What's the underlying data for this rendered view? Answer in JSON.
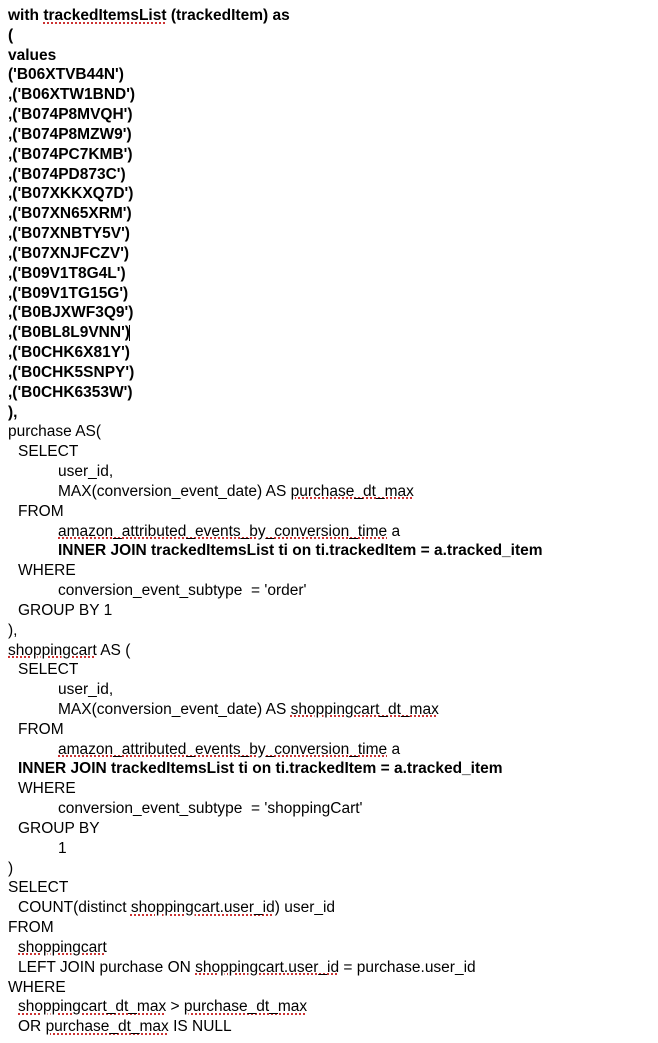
{
  "sql": {
    "with_header": {
      "pre": "with ",
      "cte_name": "trackedItemsList",
      "args": " (trackedItem) as"
    },
    "open_paren": "(",
    "values_kw": "values",
    "tracked_items": [
      "('B06XTVB44N')",
      ",('B06XTW1BND')",
      ",('B074P8MVQH')",
      ",('B074P8MZW9')",
      ",('B074PC7KMB')",
      ",('B074PD873C')",
      ",('B07XKKXQ7D')",
      ",('B07XN65XRM')",
      ",('B07XNBTY5V')",
      ",('B07XNJFCZV')",
      ",('B09V1T8G4L')",
      ",('B09V1TG15G')",
      ",('B0BJXWF3Q9')",
      ",('B0BL8L9VNN')",
      ",('B0CHK6X81Y')",
      ",('B0CHK5SNPY')",
      ",('B0CHK6353W')"
    ],
    "cursor_index": 13,
    "close_paren_comma": "),",
    "purchase_header": "purchase AS(",
    "select_kw": "SELECT",
    "user_id_col": "user_id,",
    "purchase_max": {
      "pre": "MAX(conversion_event_date) AS ",
      "spell": "purchase_dt_max"
    },
    "from_kw": "FROM",
    "table_a": {
      "spell": "amazon_attributed_events_by_conversion_time",
      "suffix": " a"
    },
    "join1": "INNER JOIN trackedItemsList ti on ti.trackedItem = a.tracked_item",
    "where_kw": "WHERE",
    "where_order": "conversion_event_subtype  = 'order'",
    "group_by_kw": "GROUP BY 1",
    "shoppingcart_header": {
      "spell": "shoppingcart",
      "suffix": " AS ("
    },
    "shoppingcart_max": {
      "pre": "MAX(conversion_event_date) AS ",
      "spell": "shoppingcart_dt_max"
    },
    "join2": "INNER JOIN trackedItemsList ti on ti.trackedItem = a.tracked_item",
    "where_cart": "conversion_event_subtype  = 'shoppingCart'",
    "group_by_only": "GROUP BY",
    "one": "1",
    "close_paren": ")",
    "final_select_count": {
      "pre": "COUNT(distinct ",
      "spell": "shoppingcart.user_id",
      "suffix": ") user_id"
    },
    "from_shoppingcart": {
      "spell": "shoppingcart"
    },
    "left_join": {
      "pre": "LEFT JOIN purchase ON ",
      "spell": "shoppingcart.user_id",
      "suffix": " = purchase.user_id"
    },
    "final_where1": {
      "spell1": "shoppingcart_dt_max",
      "mid": " > ",
      "spell2": "purchase_dt_max"
    },
    "final_where2": {
      "pre": "OR ",
      "spell": "purchase_dt_max",
      "suffix": " IS NULL"
    }
  }
}
